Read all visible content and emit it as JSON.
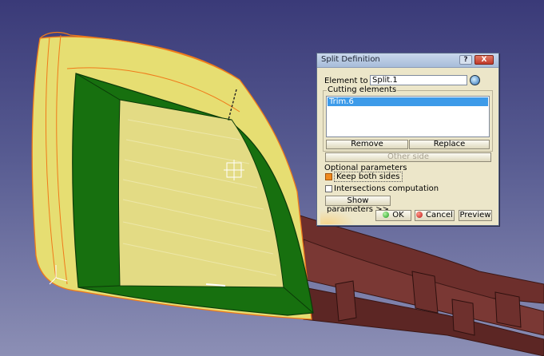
{
  "dialog": {
    "title": "Split Definition",
    "help_label": "?",
    "close_label": "X",
    "element_to_cut_label": "Element to cut:",
    "element_to_cut_value": "Split.1",
    "cutting_group_label": "Cutting elements",
    "cutting_elements": [
      "Trim.6"
    ],
    "remove_label": "Remove",
    "replace_label": "Replace",
    "other_side_label": "Other side",
    "optional_label": "Optional parameters",
    "keep_both_label": "Keep both sides",
    "keep_both_checked": true,
    "intersections_label": "Intersections computation",
    "intersections_checked": false,
    "show_params_label": "Show parameters >>",
    "ok_label": "OK",
    "cancel_label": "Cancel",
    "preview_label": "Preview"
  },
  "colors": {
    "yellow_surface": "#e8e07a",
    "green_surface": "#17700f",
    "brown_part": "#6b2f2c",
    "orange_edge": "#f07a1a",
    "selection_blue": "#3d9be9",
    "dialog_bg": "#ece6c9"
  }
}
